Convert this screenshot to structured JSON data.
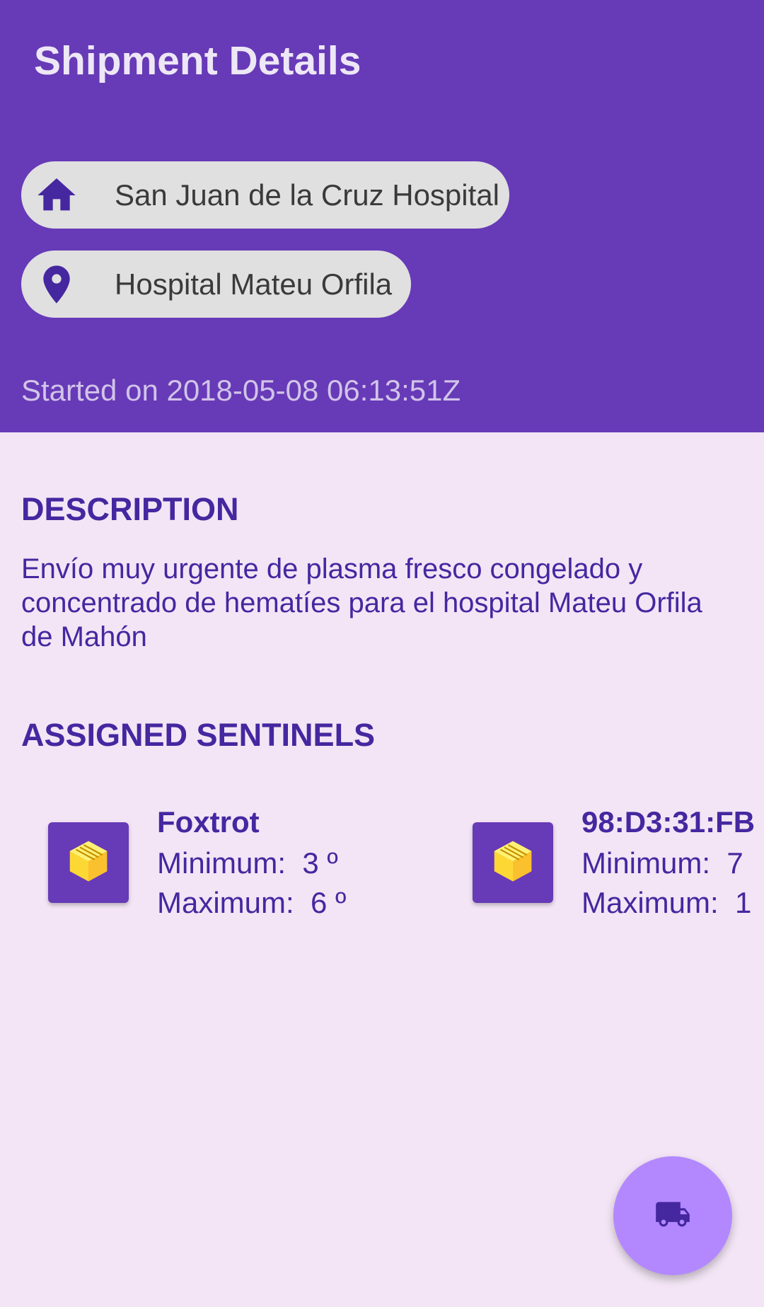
{
  "app_bar": {
    "title": "Shipment Details"
  },
  "route": {
    "origin": {
      "icon": "home-icon",
      "label": "San Juan de la Cruz Hospital"
    },
    "destination": {
      "icon": "location-pin-icon",
      "label": "Hospital Mateu Orfila"
    }
  },
  "started_text": "Started on 2018-05-08 06:13:51Z",
  "description": {
    "heading": "DESCRIPTION",
    "text": "Envío muy urgente de plasma fresco congelado y concentrado de hematíes para el hospital Mateu Orfila de Mahón"
  },
  "sentinels": {
    "heading": "ASSIGNED SENTINELS",
    "items": [
      {
        "name": "Foxtrot",
        "min_label": "Minimum:",
        "min_value": "3 º",
        "max_label": "Maximum:",
        "max_value": "6 º",
        "icon": "package-box-icon"
      },
      {
        "name": "98:D3:31:FB",
        "min_label": "Minimum:",
        "min_value": "7",
        "max_label": "Maximum:",
        "max_value": "1",
        "icon": "package-box-icon"
      }
    ]
  },
  "fab": {
    "icon": "truck-icon"
  },
  "colors": {
    "primary": "#673ab7",
    "primary_dark_text": "#4527a0",
    "background": "#f3e5f5",
    "chip": "#e0e0e0",
    "fab": "#b388ff",
    "box_yellow": "#fdd835"
  }
}
